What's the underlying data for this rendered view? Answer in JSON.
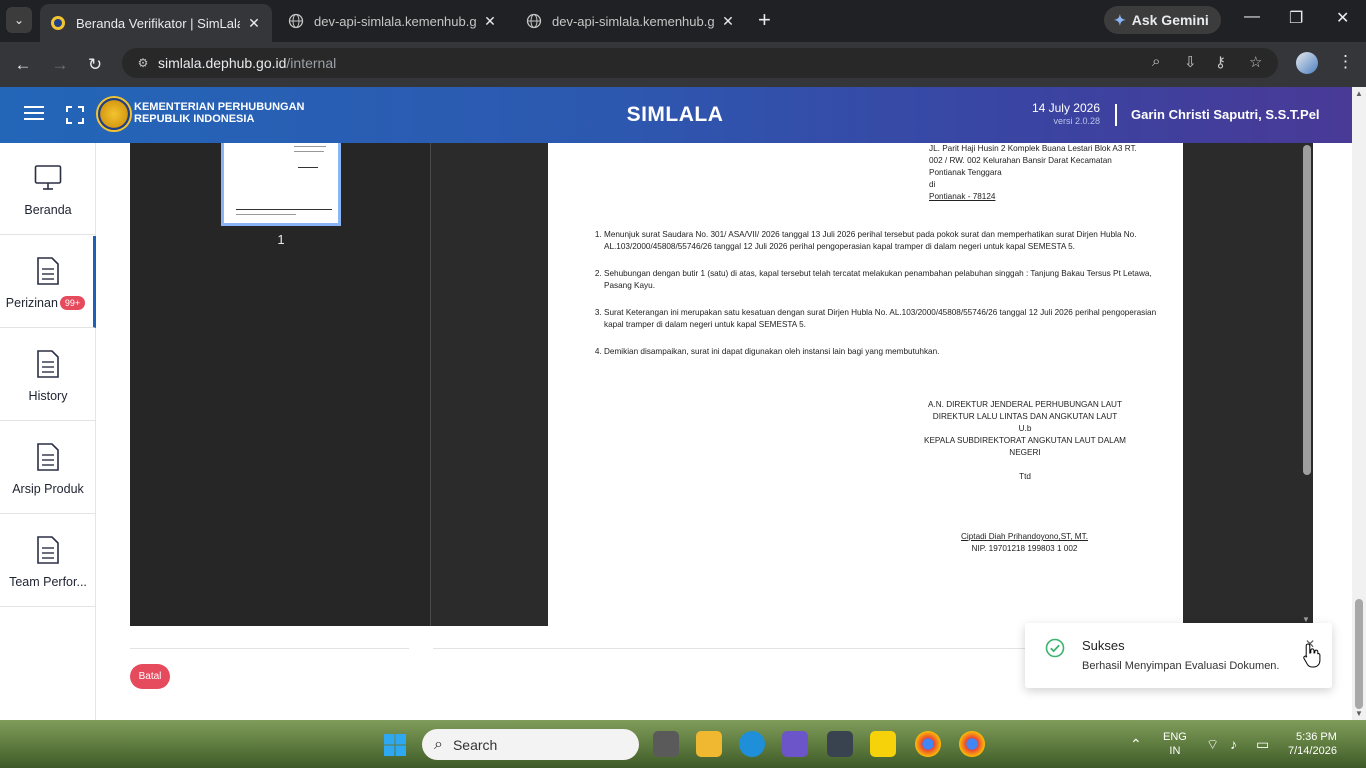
{
  "browser": {
    "tabs": [
      {
        "title": "Beranda Verifikator | SimLala",
        "active": true
      },
      {
        "title": "dev-api-simlala.kemenhub.go.id",
        "active": false
      },
      {
        "title": "dev-api-simlala.kemenhub.go.id",
        "active": false
      }
    ],
    "gemini_label": "Ask Gemini",
    "url_host": "simlala.dephub.go.id",
    "url_path": "/internal"
  },
  "header": {
    "ministry_line1": "KEMENTERIAN PERHUBUNGAN",
    "ministry_line2": "REPUBLIK INDONESIA",
    "app_title": "SIMLALA",
    "date": "14 July 2026",
    "version": "versi 2.0.28",
    "user_name": "Garin Christi Saputri, S.S.T.Pel"
  },
  "sidebar": {
    "items": [
      {
        "label": "Beranda",
        "icon": "monitor-icon"
      },
      {
        "label": "Perizinan",
        "icon": "document-icon",
        "badge": "99+"
      },
      {
        "label": "History",
        "icon": "document-icon"
      },
      {
        "label": "Arsip Produk",
        "icon": "document-icon"
      },
      {
        "label": "Team Perfor...",
        "icon": "document-icon"
      }
    ]
  },
  "viewer": {
    "page_number": "1",
    "address": {
      "line1": "JL. Parit Haji Husin 2 Komplek Buana Lestari Blok A3 RT.",
      "line2": "002 / RW. 002 Kelurahan Bansir Darat Kecamatan",
      "line3": "Pontianak Tenggara",
      "line4": "di",
      "line5": "Pontianak  - 78124"
    },
    "paragraphs": [
      "Menunjuk surat Saudara No.  301/ ASA/VII/ 2026 tanggal  13 Juli 2026 perihal tersebut pada pokok surat dan memperhatikan surat Dirjen Hubla No.  AL.103/2000/45808/55746/26 tanggal  12 Juli 2026 perihal pengoperasian kapal tramper di dalam negeri untuk kapal SEMESTA 5.",
      "Sehubungan dengan butir 1 (satu) di atas, kapal tersebut telah tercatat melakukan penambahan pelabuhan singgah : Tanjung Bakau Tersus Pt Letawa, Pasang Kayu.",
      "Surat Keterangan ini merupakan satu kesatuan dengan surat Dirjen Hubla No.  AL.103/2000/45808/55746/26 tanggal  12 Juli 2026 perihal pengoperasian kapal tramper di dalam negeri untuk kapal SEMESTA 5.",
      "Demikian disampaikan,  surat ini dapat  digunakan oleh instansi lain bagi yang membutuhkan."
    ],
    "sign": {
      "line1": "A.N. DIREKTUR JENDERAL PERHUBUNGAN LAUT",
      "line2": "DIREKTUR LALU LINTAS DAN ANGKUTAN LAUT",
      "line3": "U.b",
      "line4": "KEPALA SUBDIREKTORAT ANGKUTAN LAUT DALAM",
      "line5": "NEGERI",
      "ttd": "Ttd",
      "name": "Ciptadi Diah Prihandoyono,ST, MT.",
      "nip": "NIP. 19701218 199803 1 002"
    }
  },
  "actions": {
    "cancel_label": "Batal"
  },
  "toast": {
    "title": "Sukses",
    "message": "Berhasil Menyimpan Evaluasi Dokumen."
  },
  "taskbar": {
    "search_placeholder": "Search",
    "lang_line1": "ENG",
    "lang_line2": "IN",
    "time": "5:36 PM",
    "date": "7/14/2026"
  }
}
